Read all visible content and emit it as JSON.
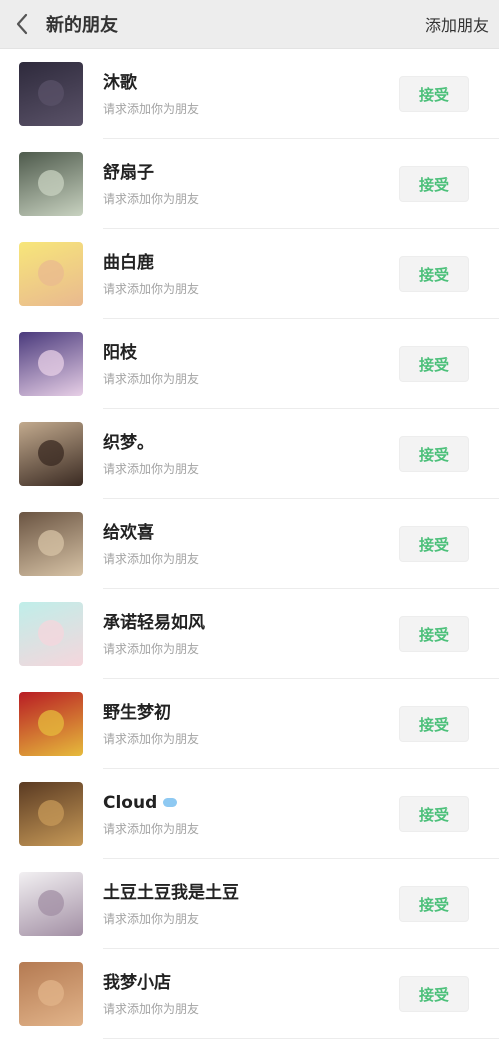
{
  "header": {
    "title": "新的朋友",
    "action_label": "添加朋友"
  },
  "rows": [
    {
      "name": "沐歌",
      "sub": "请求添加你为朋友",
      "button": "接受",
      "avatar_colors": [
        "#2e2a3c",
        "#5a5268"
      ],
      "verified": false
    },
    {
      "name": "舒扇子",
      "sub": "请求添加你为朋友",
      "button": "接受",
      "avatar_colors": [
        "#4e5a4c",
        "#c8d2c0"
      ],
      "verified": false
    },
    {
      "name": "曲白鹿",
      "sub": "请求添加你为朋友",
      "button": "接受",
      "avatar_colors": [
        "#f7e67a",
        "#e9b98f"
      ],
      "verified": false
    },
    {
      "name": "阳枝",
      "sub": "请求添加你为朋友",
      "button": "接受",
      "avatar_colors": [
        "#4a3a7c",
        "#e7cfe6"
      ],
      "verified": false
    },
    {
      "name": "织梦。",
      "sub": "请求添加你为朋友",
      "button": "接受",
      "avatar_colors": [
        "#c2aa8e",
        "#3a2a22"
      ],
      "verified": false
    },
    {
      "name": "给欢喜",
      "sub": "请求添加你为朋友",
      "button": "接受",
      "avatar_colors": [
        "#6a5442",
        "#d7c3a6"
      ],
      "verified": false
    },
    {
      "name": "承诺轻易如风",
      "sub": "请求添加你为朋友",
      "button": "接受",
      "avatar_colors": [
        "#bfeee9",
        "#f5d6dc"
      ],
      "verified": false
    },
    {
      "name": "野生梦初",
      "sub": "请求添加你为朋友",
      "button": "接受",
      "avatar_colors": [
        "#b81c24",
        "#e6bb3c"
      ],
      "verified": false
    },
    {
      "name": "Cloud",
      "sub": "请求添加你为朋友",
      "button": "接受",
      "avatar_colors": [
        "#5a3a22",
        "#c79a58"
      ],
      "verified": true
    },
    {
      "name": "土豆土豆我是土豆",
      "sub": "请求添加你为朋友",
      "button": "接受",
      "avatar_colors": [
        "#f2f0f2",
        "#a28fa4"
      ],
      "verified": false
    },
    {
      "name": "我梦小店",
      "sub": "请求添加你为朋友",
      "button": "接受",
      "avatar_colors": [
        "#b47a52",
        "#e2b48a"
      ],
      "verified": false
    }
  ]
}
